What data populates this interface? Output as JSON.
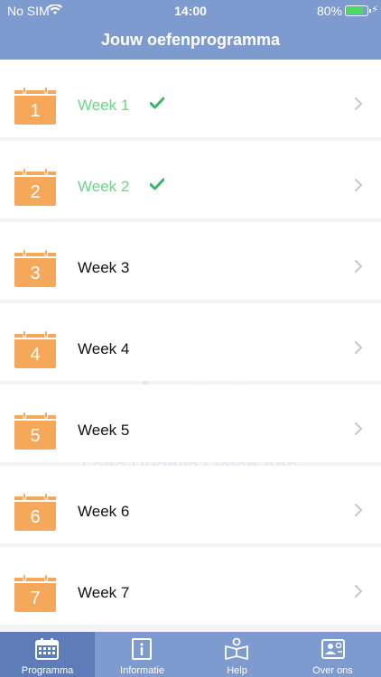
{
  "status_bar": {
    "carrier": "No SIM",
    "time": "14:00",
    "battery_percent": "80%",
    "battery_level": 0.8,
    "wifi_icon": "wifi-icon",
    "charging_icon": "bolt-icon"
  },
  "header": {
    "title": "Jouw oefenprogramma"
  },
  "weeks": [
    {
      "number": "1",
      "label": "Week 1",
      "completed": true
    },
    {
      "number": "2",
      "label": "Week 2",
      "completed": true
    },
    {
      "number": "3",
      "label": "Week 3",
      "completed": false
    },
    {
      "number": "4",
      "label": "Week 4",
      "completed": false
    },
    {
      "number": "5",
      "label": "Week 5",
      "completed": false
    },
    {
      "number": "6",
      "label": "Week 6",
      "completed": false
    },
    {
      "number": "7",
      "label": "Week 7",
      "completed": false
    }
  ],
  "watermark": {
    "line1": "audio",
    "line2": "fysio",
    "domain": ".nl",
    "tagline": "Lage Rugpijn Oefen App"
  },
  "tabs": [
    {
      "label": "Programma",
      "icon": "calendar-icon",
      "active": true
    },
    {
      "label": "Informatie",
      "icon": "info-book-icon",
      "active": false
    },
    {
      "label": "Help",
      "icon": "help-book-icon",
      "active": false
    },
    {
      "label": "Over ons",
      "icon": "contact-card-icon",
      "active": false
    }
  ],
  "colors": {
    "header": "#7e9bd0",
    "tab_active": "#5e7db8",
    "calendar": "#f5a75a",
    "completed_text": "#6cd58a",
    "check": "#3cb56a",
    "battery": "#4cd964"
  }
}
